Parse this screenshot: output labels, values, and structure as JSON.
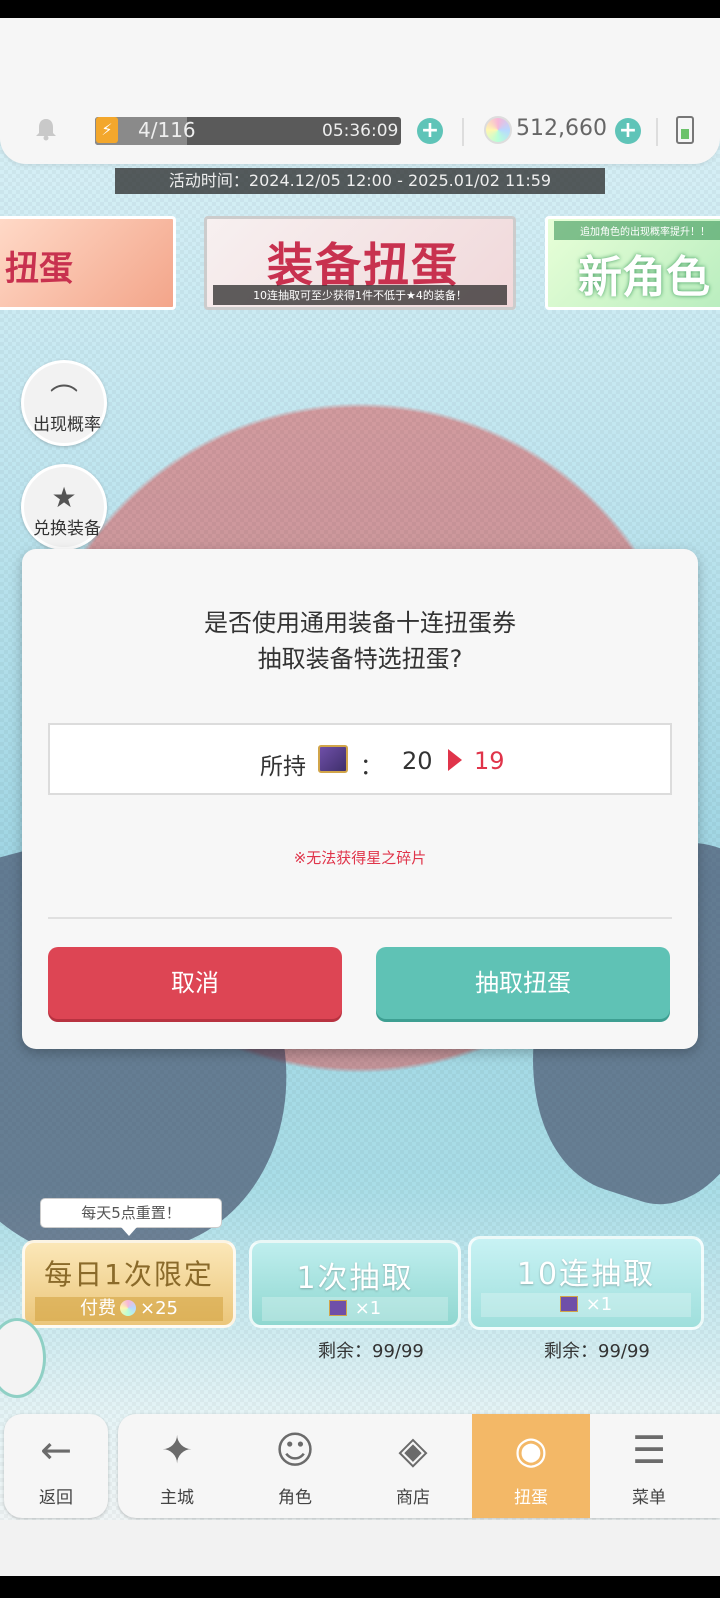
{
  "topbar": {
    "energy": "4/116",
    "energy_timer": "05:36:09",
    "gems": "512,660"
  },
  "event_time": "活动时间：2024.12/05 12:00 - 2025.01/02 11:59",
  "banners": {
    "left_title": "扭蛋",
    "center_title": "装备扭蛋",
    "center_caption": "10连抽取可至少获得1件不低于★4的装备！",
    "right_title": "新角色",
    "right_subtitle": "追加角色的出现概率提升！！"
  },
  "side": {
    "rate_label": "出现概率",
    "exchange_label": "兑换装备"
  },
  "dialog": {
    "question_line1": "是否使用通用装备十连扭蛋券",
    "question_line2": "抽取装备特选扭蛋?",
    "hold_label": "所持",
    "hold_colon": "：",
    "hold_before": "20",
    "hold_after": "19",
    "notice": "※无法获得星之碎片",
    "cancel_label": "取消",
    "confirm_label": "抽取扭蛋"
  },
  "gacha": {
    "reset_tip": "每天5点重置！",
    "daily_title": "每日1次限定",
    "daily_cost": "付费  ×25",
    "daily_cost_prefix": "付费",
    "daily_cost_amount": "×25",
    "one_title": "1次抽取",
    "one_cost": "×1",
    "ten_title": "10连抽取",
    "ten_cost": "×1",
    "one_remain": "剩余：99/99",
    "ten_remain": "剩余：99/99"
  },
  "nav": {
    "back": "返回",
    "home": "主城",
    "character": "角色",
    "shop": "商店",
    "gacha": "扭蛋",
    "menu": "菜单"
  },
  "colors": {
    "cancel": "#dd4554",
    "confirm": "#5fc2b5",
    "accent_red": "#e0344a",
    "nav_active": "#f3b867"
  }
}
